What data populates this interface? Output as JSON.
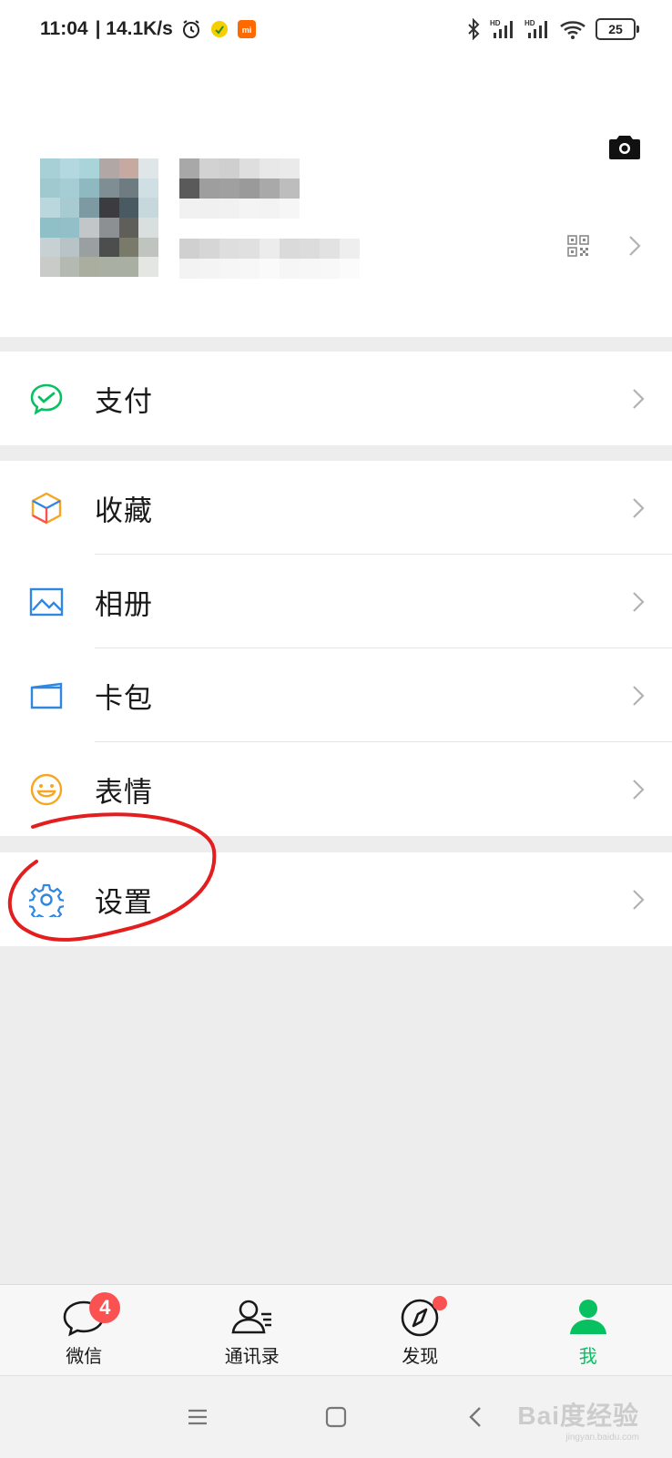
{
  "status_bar": {
    "time": "11:04",
    "speed": "| 14.1K/s",
    "battery": "25",
    "signal_tag_1": "HD",
    "signal_tag_2": "HD"
  },
  "menu": {
    "pay": "支付",
    "favorites": "收藏",
    "album": "相册",
    "cards": "卡包",
    "stickers": "表情",
    "settings": "设置"
  },
  "tabs": [
    {
      "label": "微信",
      "badge": "4",
      "icon": "chat-bubble-icon"
    },
    {
      "label": "通讯录",
      "icon": "contacts-icon"
    },
    {
      "label": "发现",
      "icon": "compass-icon",
      "dot": true
    },
    {
      "label": "我",
      "icon": "person-icon",
      "active": true
    }
  ],
  "colors": {
    "accent": "#07c160",
    "badge": "#fa5151",
    "annotation": "#e41e1e"
  },
  "watermark": {
    "text": "Bai度经验",
    "sub": "jingyan.baidu.com"
  }
}
